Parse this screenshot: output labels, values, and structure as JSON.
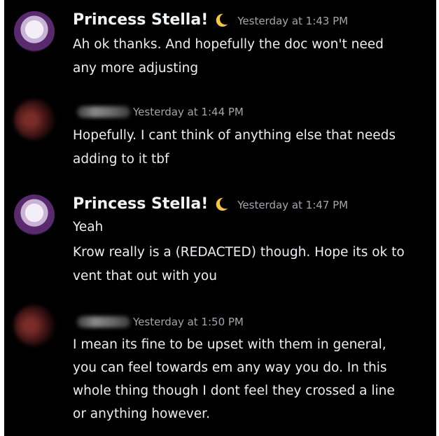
{
  "messages": [
    {
      "author": "Princess Stella!",
      "timestamp": "Yesterday at 1:43 PM",
      "lines": [
        "Ah ok thanks. And hopefully the doc won't need",
        "any more adjusting"
      ]
    },
    {
      "author": "",
      "timestamp": "Yesterday at 1:44 PM",
      "lines": [
        "Hopefully. I cant think of anything else that needs",
        "adding to it tbf"
      ]
    },
    {
      "author": "Princess Stella!",
      "timestamp": "Yesterday at 1:47 PM",
      "lines": [
        "Yeah",
        "Krow really is a (REDACTED) though. Hope its ok to",
        "vent that out with you"
      ]
    },
    {
      "author": "",
      "timestamp": "Yesterday at 1:50 PM",
      "lines": [
        "I mean its fine to be upset with them in general,",
        "you can feel towards em any way you do. In this",
        "whole thing though I dont feel they crossed a line",
        "or anything however."
      ]
    }
  ],
  "icons": {
    "moon": "crescent-moon-icon"
  },
  "colors": {
    "background": "#000000",
    "author": "#f2f3f5",
    "timestamp": "#a3a6aa",
    "text": "#eceef0",
    "moon": "#f5c542"
  }
}
